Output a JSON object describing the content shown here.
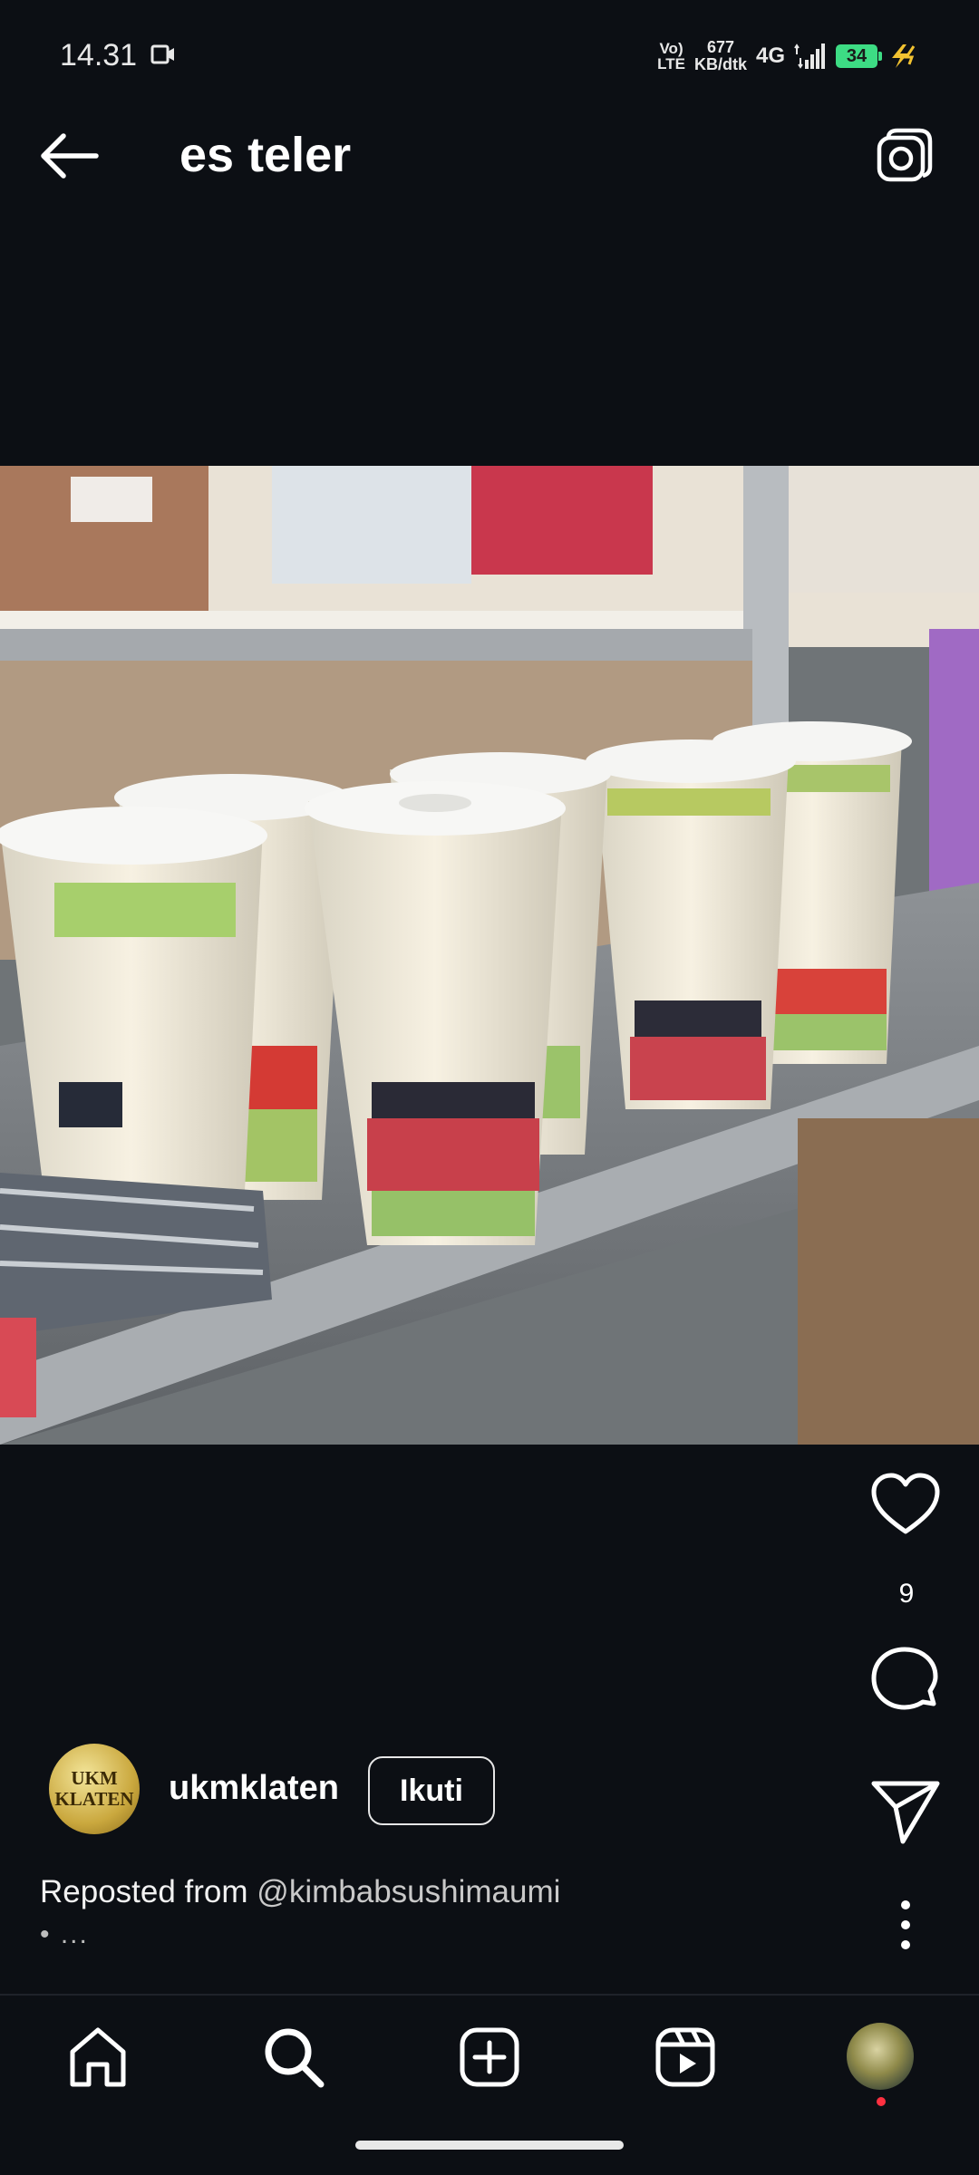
{
  "status_bar": {
    "time": "14.31",
    "volte_top": "Vo)",
    "volte_bottom": "LTE",
    "net_speed_value": "677",
    "net_speed_unit": "KB/dtk",
    "network": "4G",
    "battery": "34"
  },
  "header": {
    "title": "es teler"
  },
  "post": {
    "like_count": "9",
    "author": {
      "avatar_text_line1": "UKM",
      "avatar_text_line2": "KLATEN",
      "username": "ukmklaten",
      "follow_label": "Ikuti"
    },
    "caption": {
      "prefix": "Reposted from",
      "handle": "@kimbabsushimaumi",
      "more": "• ..."
    }
  },
  "colors": {
    "background": "#0c0f14",
    "notification": "#ff3040",
    "battery": "#3ddc84"
  }
}
